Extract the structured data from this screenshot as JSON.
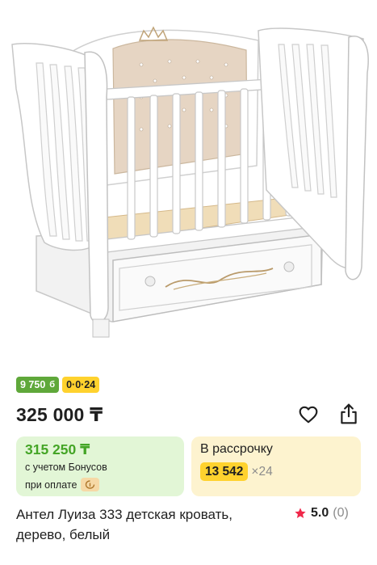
{
  "product": {
    "image_alt": "white crib with drawer",
    "badges": {
      "bonus": "9 750",
      "bonus_icon": "б",
      "installment": "0·0·24"
    },
    "price": "325 000 ₸",
    "bonus_card": {
      "price": "315 250 ₸",
      "line1": "с учетом Бонусов",
      "line2": "при оплате",
      "icon": "card-icon"
    },
    "installment": {
      "title": "В рассрочку",
      "amount": "13 542",
      "multiplier": "×24"
    },
    "title": "Антел Луиза 333 детская кровать, дерево, белый",
    "rating": {
      "value": "5.0",
      "count": "(0)"
    }
  },
  "colors": {
    "bonus_green": "#5fa83a",
    "bonus_text_green": "#44a526",
    "bonus_bg": "#e2f6d6",
    "installment_yellow": "#ffd22e",
    "installment_bg": "#fdf3cf",
    "star_red": "#f0284a"
  }
}
